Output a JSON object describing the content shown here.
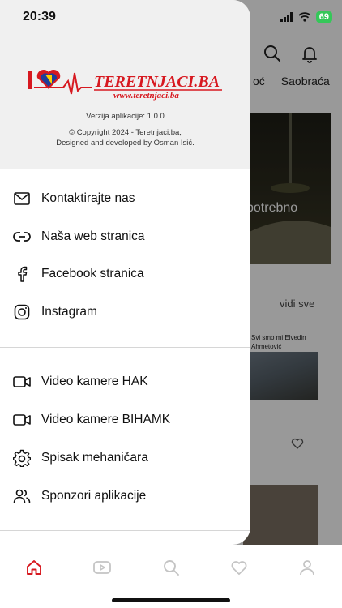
{
  "status_bar": {
    "time": "20:39",
    "battery": "69"
  },
  "background": {
    "tabs": [
      "oć",
      "Saobraća"
    ],
    "hero_caption": "potrebno",
    "section_link": "vidi sve",
    "card_caption": "Svi smo mi Elvedin Ahmetović"
  },
  "drawer": {
    "logo": {
      "brand": "TERETNJACI.BA",
      "url": "www.teretnjaci.ba",
      "colors": {
        "red": "#d71920",
        "blue": "#1f3f9a",
        "yellow": "#ffd100"
      }
    },
    "version": "Verzija aplikacije: 1.0.0",
    "copyright_line1": "© Copyright 2024 - Teretnjaci.ba,",
    "copyright_line2": "Designed and developed by Osman Isić.",
    "menu_group_1": [
      {
        "label": "Kontaktirajte nas",
        "icon": "mail-icon"
      },
      {
        "label": "Naša web stranica",
        "icon": "link-icon"
      },
      {
        "label": "Facebook stranica",
        "icon": "facebook-icon"
      },
      {
        "label": "Instagram",
        "icon": "instagram-icon"
      }
    ],
    "menu_group_2": [
      {
        "label": "Video kamere HAK",
        "icon": "video-camera-icon"
      },
      {
        "label": "Video kamere BIHAMK",
        "icon": "video-camera-icon"
      },
      {
        "label": "Spisak mehaničara",
        "icon": "gear-icon"
      },
      {
        "label": "Sponzori aplikacije",
        "icon": "users-icon"
      }
    ]
  },
  "tab_bar": {
    "active_color": "#d71920",
    "inactive_color": "#c4c4c4",
    "tabs": [
      "home-icon",
      "video-play-icon",
      "search-icon",
      "heart-icon",
      "profile-icon"
    ]
  }
}
